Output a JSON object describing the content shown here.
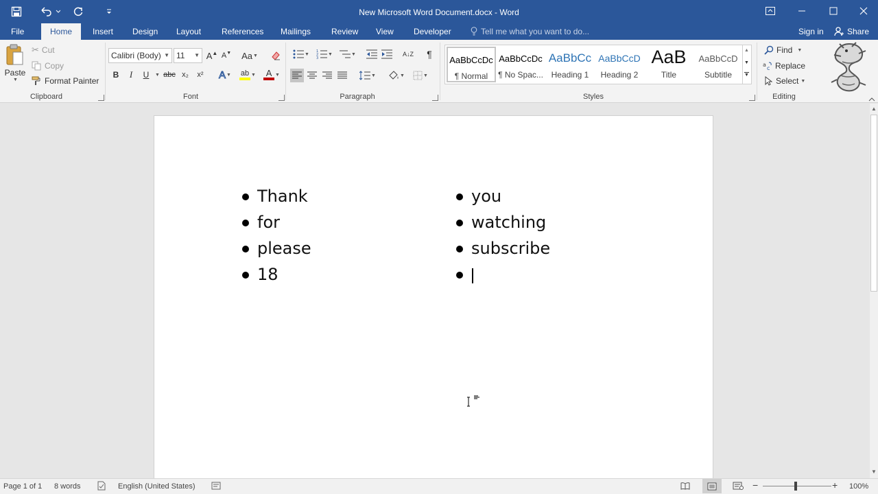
{
  "window": {
    "title": "New Microsoft Word Document.docx - Word"
  },
  "tabs": {
    "file": "File",
    "home": "Home",
    "insert": "Insert",
    "design": "Design",
    "layout": "Layout",
    "references": "References",
    "mailings": "Mailings",
    "review": "Review",
    "view": "View",
    "developer": "Developer",
    "tell_me": "Tell me what you want to do...",
    "sign_in": "Sign in",
    "share": "Share"
  },
  "clipboard": {
    "paste": "Paste",
    "cut": "Cut",
    "copy": "Copy",
    "format_painter": "Format Painter",
    "label": "Clipboard"
  },
  "font": {
    "family": "Calibri (Body)",
    "size": "11",
    "case_label": "Aa",
    "bold": "B",
    "italic": "I",
    "underline": "U",
    "strike": "abc",
    "subscript": "x₂",
    "superscript": "x²",
    "text_effects": "A",
    "highlight": "ab",
    "font_color": "A",
    "label": "Font",
    "highlight_color": "#ffff00",
    "font_color_value": "#c00000"
  },
  "paragraph": {
    "label": "Paragraph",
    "pilcrow": "¶",
    "sort": "A↓Z"
  },
  "styles": {
    "label": "Styles",
    "items": [
      {
        "sample": "AaBbCcDc",
        "name": "¶ Normal"
      },
      {
        "sample": "AaBbCcDc",
        "name": "¶ No Spac..."
      },
      {
        "sample": "AaBbCc",
        "name": "Heading 1"
      },
      {
        "sample": "AaBbCcD",
        "name": "Heading 2"
      },
      {
        "sample": "AaB",
        "name": "Title"
      },
      {
        "sample": "AaBbCcD",
        "name": "Subtitle"
      }
    ]
  },
  "editing": {
    "find": "Find",
    "replace": "Replace",
    "select": "Select",
    "label": "Editing"
  },
  "document": {
    "left_column": [
      "Thank",
      "for",
      "please",
      "18"
    ],
    "right_column": [
      "you",
      "watching",
      "subscribe",
      ""
    ]
  },
  "status": {
    "page": "Page 1 of 1",
    "words": "8 words",
    "language": "English (United States)",
    "zoom": "100%"
  },
  "colors": {
    "accent": "#2b579a",
    "ribbon_bg": "#f3f3f3",
    "heading_blue": "#2e74b5"
  }
}
